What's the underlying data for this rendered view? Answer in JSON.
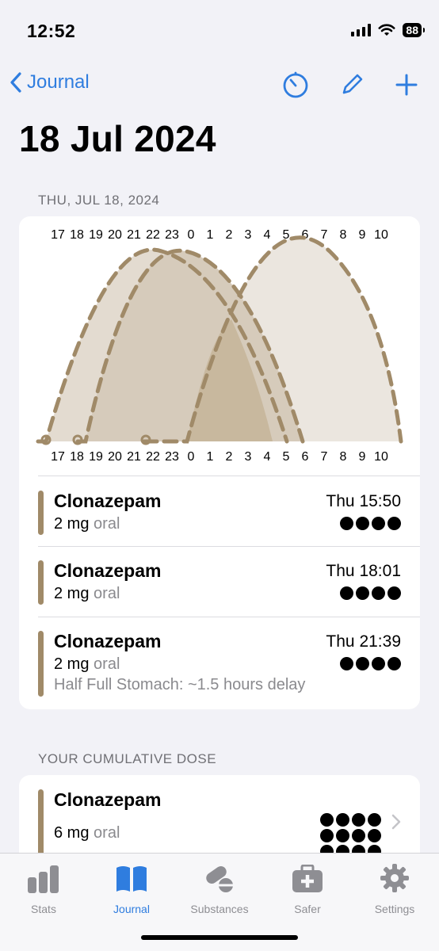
{
  "status_bar": {
    "time": "12:52",
    "battery": "88"
  },
  "nav": {
    "back_label": "Journal",
    "icons": [
      "timer-icon",
      "pencil-icon",
      "plus-icon"
    ]
  },
  "page": {
    "title": "18 Jul 2024"
  },
  "timeline_section": {
    "header": "THU, JUL 18, 2024",
    "hour_labels": [
      "17",
      "18",
      "19",
      "20",
      "21",
      "22",
      "23",
      "0",
      "1",
      "2",
      "3",
      "4",
      "5",
      "6",
      "7",
      "8",
      "9",
      "10"
    ]
  },
  "entries": [
    {
      "name": "Clonazepam",
      "dose": "2 mg",
      "route": "oral",
      "time": "Thu 15:50",
      "dots": 4,
      "note": ""
    },
    {
      "name": "Clonazepam",
      "dose": "2 mg",
      "route": "oral",
      "time": "Thu 18:01",
      "dots": 4,
      "note": ""
    },
    {
      "name": "Clonazepam",
      "dose": "2 mg",
      "route": "oral",
      "time": "Thu 21:39",
      "dots": 4,
      "note": "Half Full Stomach: ~1.5 hours delay"
    }
  ],
  "cumulative_section": {
    "header": "YOUR CUMULATIVE DOSE",
    "name": "Clonazepam",
    "dose": "6 mg",
    "route": "oral",
    "dots": 12
  },
  "tab_bar": {
    "tabs": [
      {
        "label": "Stats",
        "icon": "bar-chart-icon",
        "active": false
      },
      {
        "label": "Journal",
        "icon": "book-icon",
        "active": true
      },
      {
        "label": "Substances",
        "icon": "pills-icon",
        "active": false
      },
      {
        "label": "Safer",
        "icon": "medical-kit-icon",
        "active": false
      },
      {
        "label": "Settings",
        "icon": "gear-icon",
        "active": false
      }
    ]
  },
  "colors": {
    "accent": "#2f7ddf",
    "substance": "#a08a68",
    "chart_fill": "#c8b89e"
  }
}
